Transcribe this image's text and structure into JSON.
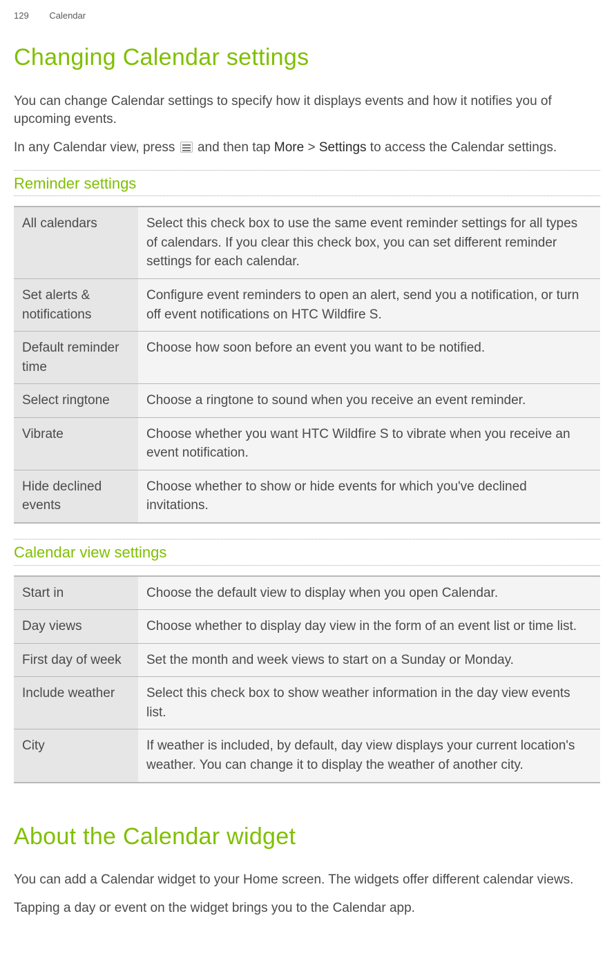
{
  "header": {
    "page_number": "129",
    "section": "Calendar"
  },
  "title1": "Changing Calendar settings",
  "intro1": "You can change Calendar settings to specify how it displays events and how it notifies you of upcoming events.",
  "intro2_pre": "In any Calendar view, press ",
  "intro2_post_a": " and then tap ",
  "intro2_more": "More",
  "intro2_gt": " > ",
  "intro2_settings": "Settings",
  "intro2_tail": " to access the Calendar settings.",
  "reminder_heading": "Reminder settings",
  "reminder_rows": [
    {
      "label": "All calendars",
      "desc": "Select this check box to use the same event reminder settings for all types of calendars. If you clear this check box, you can set different reminder settings for each calendar."
    },
    {
      "label": "Set alerts & notifications",
      "desc": "Configure event reminders to open an alert, send you a notification, or turn off event notifications on HTC Wildfire S."
    },
    {
      "label": "Default reminder time",
      "desc": "Choose how soon before an event you want to be notified."
    },
    {
      "label": "Select ringtone",
      "desc": "Choose a ringtone to sound when you receive an event reminder."
    },
    {
      "label": "Vibrate",
      "desc": "Choose whether you want HTC Wildfire S to vibrate when you receive an event notification."
    },
    {
      "label": "Hide declined events",
      "desc": "Choose whether to show or hide events for which you've declined invitations."
    }
  ],
  "view_heading": "Calendar view settings",
  "view_rows": [
    {
      "label": "Start in",
      "desc": "Choose the default view to display when you open Calendar."
    },
    {
      "label": "Day views",
      "desc": "Choose whether to display day view in the form of an event list or time list."
    },
    {
      "label": "First day of week",
      "desc": "Set the month and week views to start on a Sunday or Monday."
    },
    {
      "label": "Include weather",
      "desc": "Select this check box to show weather information in the day view events list."
    },
    {
      "label": "City",
      "desc": "If weather is included, by default, day view displays your current location's weather. You can change it to display the weather of another city."
    }
  ],
  "title2": "About the Calendar widget",
  "widget_p1": "You can add a Calendar widget to your Home screen. The widgets offer different calendar views.",
  "widget_p2": "Tapping a day or event on the widget brings you to the Calendar app."
}
